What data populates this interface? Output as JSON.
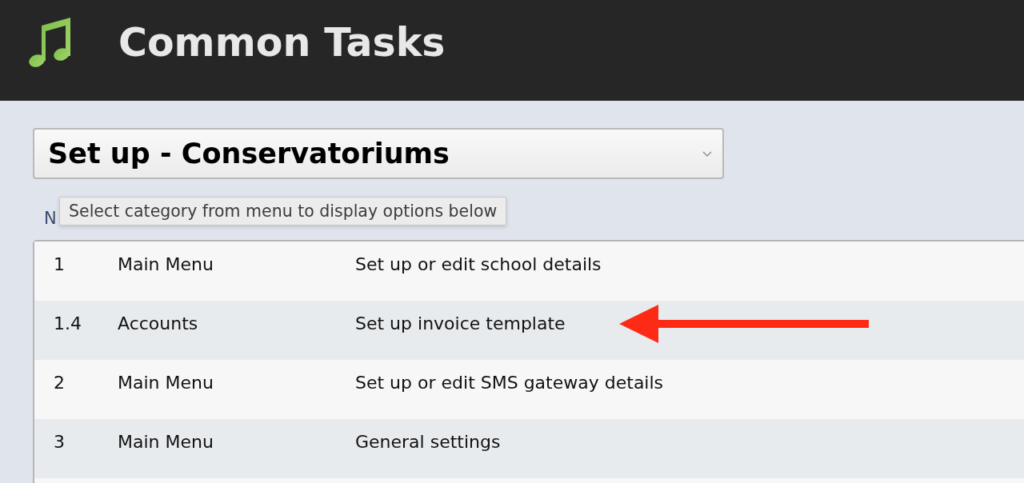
{
  "header": {
    "title": "Common Tasks"
  },
  "category_select": {
    "value": "Set up - Conservatoriums"
  },
  "tooltip": "Select category from menu to display options below",
  "table": {
    "columns": [
      "N"
    ],
    "rows": [
      {
        "cells": [
          "1",
          "Main Menu",
          "Set up or edit school details"
        ],
        "marked": false
      },
      {
        "cells": [
          "1.4",
          "Accounts",
          "Set up invoice template"
        ],
        "marked": true
      },
      {
        "cells": [
          "2",
          "Main Menu",
          "Set up or edit SMS gateway details"
        ],
        "marked": false
      },
      {
        "cells": [
          "3",
          "Main Menu",
          "General settings"
        ],
        "marked": false
      }
    ]
  }
}
